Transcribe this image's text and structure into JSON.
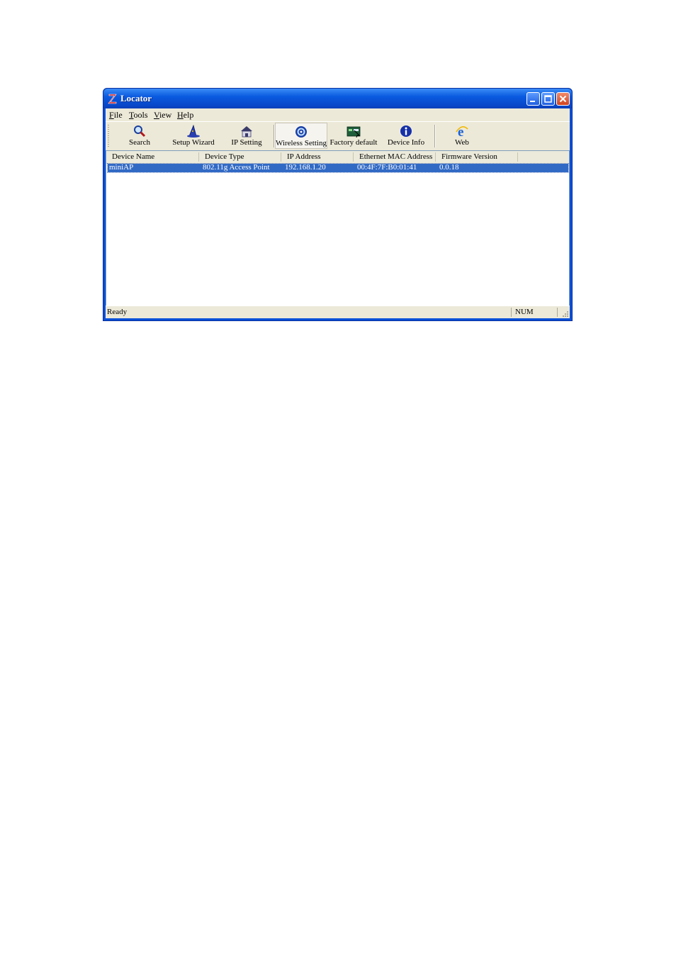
{
  "window": {
    "title": "Locator"
  },
  "menu": [
    {
      "underline": "F",
      "rest": "ile"
    },
    {
      "underline": "T",
      "rest": "ools"
    },
    {
      "underline": "V",
      "rest": "iew"
    },
    {
      "underline": "H",
      "rest": "elp"
    }
  ],
  "toolbar": {
    "search": "Search",
    "setup_wizard": "Setup Wizard",
    "ip_setting": "IP Setting",
    "wireless_setting": "Wireless Setting",
    "factory_default": "Factory default",
    "device_info": "Device Info",
    "web": "Web"
  },
  "columns": [
    "Device Name",
    "Device Type",
    "IP Address",
    "Ethernet MAC Address",
    "Firmware Version"
  ],
  "rows": [
    {
      "device_name": "miniAP",
      "device_type": "802.11g Access Point",
      "ip": "192.168.1.20",
      "mac": "00:4F:7F:B0:01:41",
      "firmware": "0.0.18"
    }
  ],
  "status": {
    "text": "Ready",
    "num": "NUM"
  },
  "colors": {
    "title_bar": "#0a5ae0",
    "selection": "#316ac5",
    "face": "#ece9d8"
  }
}
